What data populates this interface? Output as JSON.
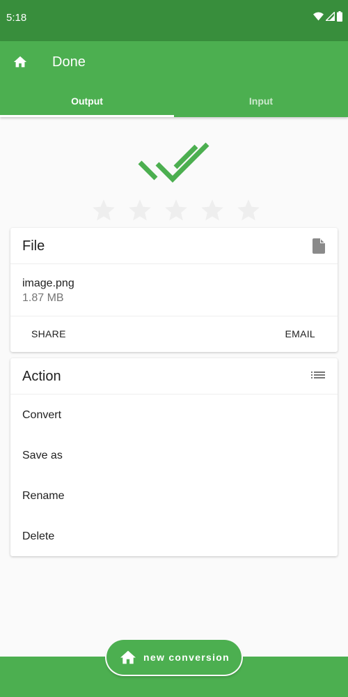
{
  "status_bar": {
    "time": "5:18",
    "icons": [
      "wifi-icon",
      "signal-icon",
      "battery-icon"
    ]
  },
  "app_bar": {
    "nav_icon": "home-icon",
    "title": "Done"
  },
  "tabs": [
    {
      "label": "Output",
      "active": true
    },
    {
      "label": "Input",
      "active": false
    }
  ],
  "status": {
    "icon": "done-all-icon",
    "rating": {
      "value": 0,
      "max": 5
    }
  },
  "file_card": {
    "title": "File",
    "icon": "file-icon",
    "file_name": "image.png",
    "file_size": "1.87 MB",
    "actions": {
      "share_label": "SHARE",
      "email_label": "EMAIL"
    }
  },
  "action_card": {
    "title": "Action",
    "icon": "list-icon",
    "items": [
      {
        "label": "Convert"
      },
      {
        "label": "Save as"
      },
      {
        "label": "Rename"
      },
      {
        "label": "Delete"
      }
    ]
  },
  "fab": {
    "icon": "home-icon",
    "label": "new conversion"
  },
  "colors": {
    "primary": "#4caf50",
    "primary_dark": "#388e3c",
    "star_empty": "#eeeeee",
    "background": "#fafafa"
  }
}
